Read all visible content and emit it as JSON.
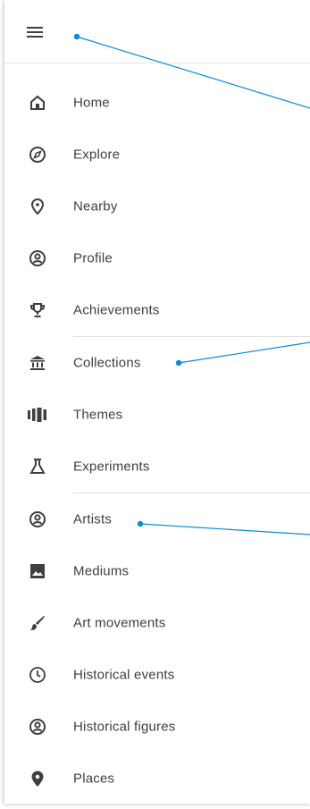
{
  "menu": {
    "items": [
      {
        "label": "Home",
        "icon": "home-icon"
      },
      {
        "label": "Explore",
        "icon": "compass-icon"
      },
      {
        "label": "Nearby",
        "icon": "location-pin-icon"
      },
      {
        "label": "Profile",
        "icon": "profile-icon"
      },
      {
        "label": "Achievements",
        "icon": "trophy-icon"
      },
      {
        "label": "Collections",
        "icon": "museum-icon"
      },
      {
        "label": "Themes",
        "icon": "themes-icon"
      },
      {
        "label": "Experiments",
        "icon": "flask-icon"
      },
      {
        "label": "Artists",
        "icon": "artist-icon"
      },
      {
        "label": "Mediums",
        "icon": "image-icon"
      },
      {
        "label": "Art movements",
        "icon": "brush-icon"
      },
      {
        "label": "Historical events",
        "icon": "clock-icon"
      },
      {
        "label": "Historical figures",
        "icon": "person-icon"
      },
      {
        "label": "Places",
        "icon": "place-pin-icon"
      }
    ]
  },
  "colors": {
    "text": "#3c4043",
    "icon": "#3c4043",
    "annotation": "#0b8ad6",
    "divider": "#e0e0e0"
  }
}
